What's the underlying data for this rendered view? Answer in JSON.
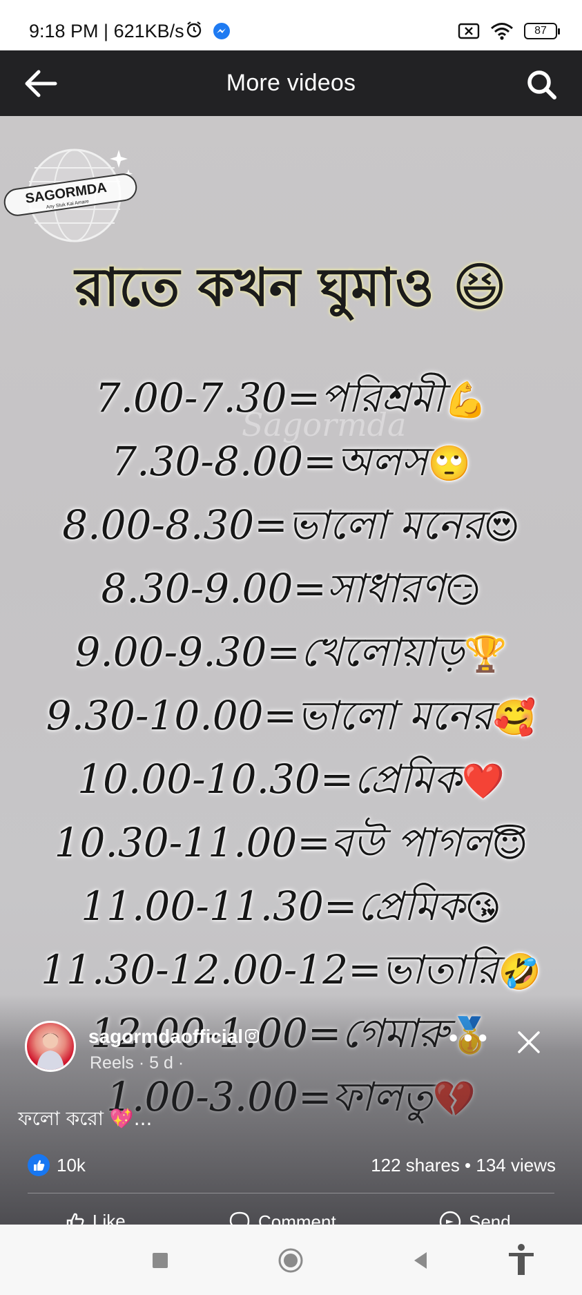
{
  "status_bar": {
    "time": "9:18 PM | 621KB/s",
    "battery": "87",
    "icons": [
      "alarm-icon",
      "messenger-icon",
      "sim-blocked-icon",
      "wifi-icon",
      "battery-icon"
    ]
  },
  "app_bar": {
    "title": "More videos",
    "back_icon": "arrow-left-icon",
    "search_icon": "search-icon"
  },
  "video": {
    "watermark": {
      "name": "SAGORMDA",
      "tagline": "Any Stuk Kai Amare",
      "overlay": "Sagormda"
    },
    "title": "রাতে কখন ঘুমাও",
    "title_emoji": "😆",
    "lines": [
      {
        "text": "7.00-7.30=পরিশ্রমী",
        "emoji": "💪"
      },
      {
        "text": "7.30-8.00=অলস",
        "emoji": "🙄"
      },
      {
        "text": "8.00-8.30=ভালো মনের",
        "emoji": "😍"
      },
      {
        "text": "8.30-9.00=সাধারণ",
        "emoji": "😏"
      },
      {
        "text": "9.00-9.30=খেলোয়াড়",
        "emoji": "🏆"
      },
      {
        "text": "9.30-10.00=ভালো মনের",
        "emoji": "🥰"
      },
      {
        "text": "10.00-10.30=প্রেমিক",
        "emoji": "❤️"
      },
      {
        "text": "10.30-11.00=বউ পাগল",
        "emoji": "😇"
      },
      {
        "text": "11.00-11.30=প্রেমিক",
        "emoji": "😘"
      },
      {
        "text": "11.30-12.00-12=ভাতারি",
        "emoji": "🤣"
      },
      {
        "text": "12.00-1.00=গেমারু",
        "emoji": "🥇"
      },
      {
        "text": "1.00-3.00=ফালতু",
        "emoji": "💔"
      }
    ]
  },
  "post": {
    "author": "sagormdaofficial",
    "meta": "Reels · 5 d ·",
    "caption": "ফলো করো 💖...",
    "more_label": "•••",
    "likes": "10k",
    "shares_views": "122 shares • 134 views",
    "actions": [
      {
        "label": "Like",
        "icon": "like-icon"
      },
      {
        "label": "Comment",
        "icon": "comment-icon"
      },
      {
        "label": "Send",
        "icon": "send-icon"
      }
    ]
  },
  "nav_bar": {
    "buttons": [
      "recents-square-icon",
      "home-circle-icon",
      "back-triangle-icon",
      "accessibility-icon"
    ]
  },
  "colors": {
    "app_bar": "#222224",
    "video_bg": "#c7c6c8",
    "like_blue": "#1877f2"
  }
}
